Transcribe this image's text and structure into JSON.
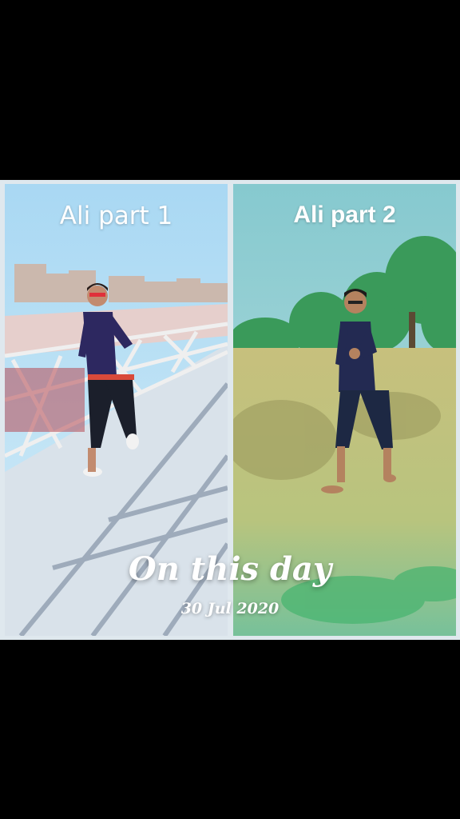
{
  "panels": [
    {
      "title": "Ali part 1"
    },
    {
      "title": "Ali part 2"
    }
  ],
  "overlay": {
    "title": "On this day",
    "date": "30 Jul 2020"
  }
}
